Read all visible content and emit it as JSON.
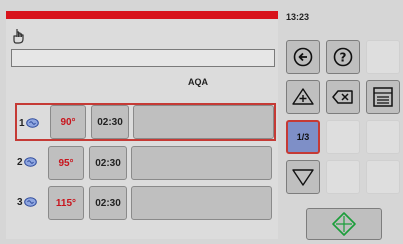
{
  "header": {
    "clock": "13:23",
    "accent_color": "#d8141c"
  },
  "program": {
    "name_value": "",
    "label": "AQA"
  },
  "rows": [
    {
      "index": "1",
      "temperature": "90°",
      "time": "02:30",
      "selected": true
    },
    {
      "index": "2",
      "temperature": "95°",
      "time": "02:30",
      "selected": false
    },
    {
      "index": "3",
      "temperature": "115°",
      "time": "02:30",
      "selected": false
    }
  ],
  "controls": {
    "back_icon": "arrow-left-circle-icon",
    "help_icon": "question-circle-icon",
    "add_icon": "triangle-plus-icon",
    "delete_icon": "backspace-icon",
    "menu_icon": "list-panel-icon",
    "page_indicator": "1/3",
    "down_icon": "triangle-down-icon",
    "start_icon": "diamond-start-icon",
    "start_color": "#1a9e3a"
  }
}
